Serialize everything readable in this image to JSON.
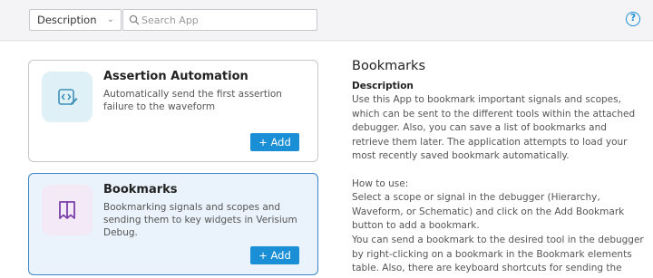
{
  "toolbar": {
    "filter_value": "Description",
    "search_placeholder": "Search App"
  },
  "apps": [
    {
      "title": "Assertion Automation",
      "description": "Automatically send the first assertion failure to the waveform",
      "add_label": "Add",
      "icon": "code-edit-icon",
      "selected": false
    },
    {
      "title": "Bookmarks",
      "description": "Bookmarking signals and scopes and sending them to key widgets in Verisium Debug.",
      "add_label": "Add",
      "icon": "bookmarks-icon",
      "selected": true
    }
  ],
  "detail": {
    "title": "Bookmarks",
    "description_label": "Description",
    "description_text": "Use this App to bookmark important signals and scopes, which can be sent to the different tools within the attached debugger. Also, you can save a list of bookmarks and retrieve them later. The application attempts to load your most recently saved bookmark automatically.",
    "how_to_use_label": "How to use:",
    "how_to_use_text_1": "Select a scope or signal in the debugger (Hierarchy, Waveform, or Schematic) and click on the Add Bookmark button to add a bookmark.",
    "how_to_use_text_2": "You can send a bookmark to the desired tool in the debugger by right-clicking on a bookmark in the Bookmark elements table. Also, there are keyboard shortcuts for sending the scopes or"
  },
  "colors": {
    "accent": "#1b8fd6",
    "selected_card_bg": "#eaf3fb",
    "selected_card_border": "#3a86c8"
  }
}
